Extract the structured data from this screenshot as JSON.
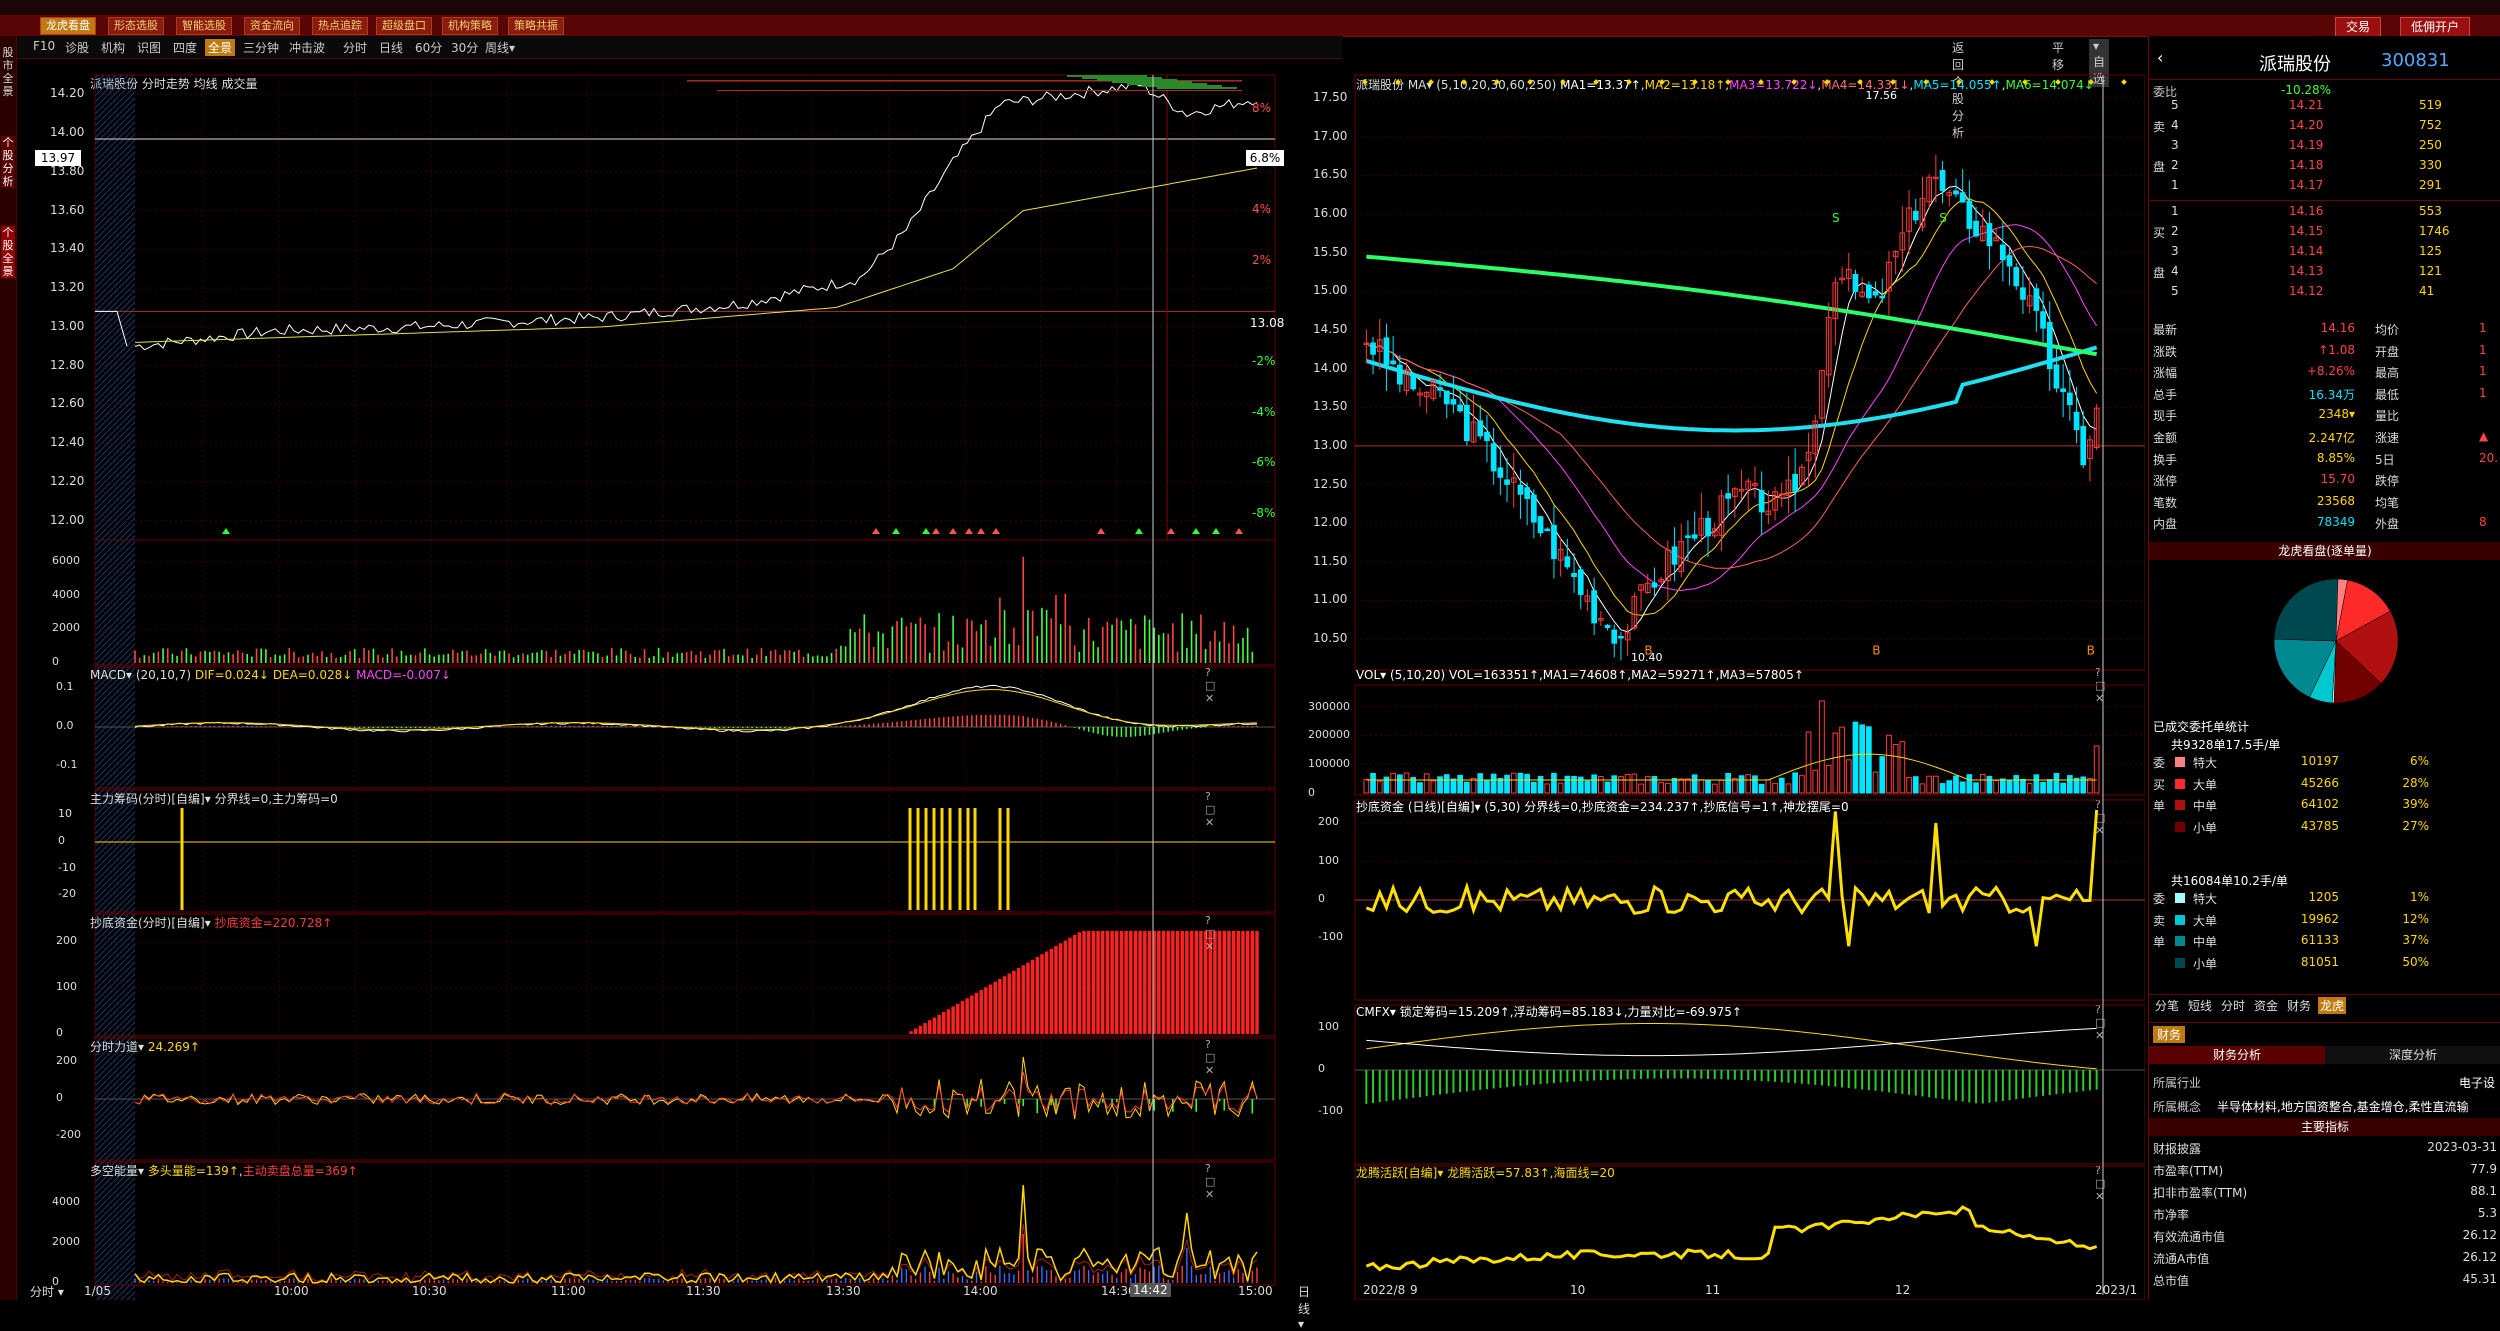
{
  "toolbar": {
    "left_buttons": [
      "龙虎看盘",
      "形态选股",
      "智能选股",
      "资金流向",
      "热点追踪",
      "超级盘口",
      "机构策略",
      "策略共振"
    ],
    "right_buttons": [
      "交易",
      "低佣开户"
    ]
  },
  "sidebar": {
    "items": [
      "股市全景",
      "个股分析",
      "个股全景"
    ]
  },
  "tabs": {
    "items": [
      "F10",
      "诊股",
      "机构",
      "识图",
      "四度",
      "全景",
      "三分钟",
      "冲击波",
      "分时",
      "日线",
      "60分",
      "30分",
      "周线▾"
    ],
    "active": "全景",
    "right_items": [
      "返回个股分析",
      "平移",
      "▾自选"
    ]
  },
  "intraday": {
    "title": "派瑞股份 分时走势 均线 成交量",
    "price_labels": [
      "14.20",
      "14.00",
      "13.80",
      "13.60",
      "13.40",
      "13.20",
      "13.00",
      "12.80",
      "12.60",
      "12.40",
      "12.20",
      "12.00"
    ],
    "pct_labels": [
      "8%",
      "6%",
      "4%",
      "2%",
      "-2%",
      "-4%",
      "-6%",
      "-8%"
    ],
    "cur_price": "13.97",
    "cur_pct": "6.8%",
    "base": "13.08",
    "vol_labels": [
      "6000",
      "4000",
      "2000",
      "0"
    ],
    "time_labels": [
      "1/05",
      "10:00",
      "10:30",
      "11:00",
      "11:30",
      "13:30",
      "14:00",
      "14:30",
      "14:42",
      "15:00"
    ],
    "bottom_left": "分时 ▾",
    "cursor_time": "14:42"
  },
  "macd_i": {
    "name": "MACD",
    "params": "(20,10,7)",
    "dif": "DIF=0.024↓",
    "dea": "DEA=0.028↓",
    "macd": "MACD=-0.007↓",
    "labels": [
      "0.1",
      "0.0",
      "-0.1"
    ]
  },
  "zhuli": {
    "name": "主力筹码(分时)[自编]",
    "text": "分界线=0,主力筹码=0",
    "labels": [
      "10",
      "0",
      "-10",
      "-20"
    ]
  },
  "chaodi_i": {
    "name": "抄底资金(分时)[自编]",
    "value": "抄底资金=220.728↑",
    "labels": [
      "200",
      "100",
      "0"
    ]
  },
  "lidao": {
    "name": "分时力道",
    "value": "24.269↑",
    "labels": [
      "200",
      "0",
      "-200"
    ]
  },
  "duokong": {
    "name": "多空能量",
    "v1": "多头量能=139↑",
    "v2": "主动卖盘总量=369↑",
    "labels": [
      "4000",
      "2000",
      "0"
    ]
  },
  "daily": {
    "title": "派瑞股份 MA▾ (5,10,20,30,60,250)",
    "ma": [
      "MA1=13.37↑",
      "MA2=13.18↑",
      "MA3=13.722↓",
      "MA4=14.331↓",
      "MA5=14.055↑",
      "MA6=14.074↓"
    ],
    "price_labels": [
      "17.50",
      "17.00",
      "16.50",
      "16.00",
      "15.50",
      "15.00",
      "14.50",
      "14.00",
      "13.50",
      "13.00",
      "12.50",
      "12.00",
      "11.50",
      "11.00",
      "10.50"
    ],
    "high_mark": "17.56",
    "low_mark": "10.40",
    "date_labels": [
      "日线 ▾",
      "2022/8",
      "9",
      "10",
      "11",
      "12",
      "2023/1"
    ]
  },
  "vol_d": {
    "title": "VOL▾ (5,10,20) VOL=163351↑,MA1=74608↑,MA2=59271↑,MA3=57805↑",
    "labels": [
      "300000",
      "200000",
      "100000",
      "0"
    ]
  },
  "chaodi_d": {
    "title": "抄底资金 (日线)[自编]▾ (5,30) 分界线=0,抄底资金=234.237↑,抄底信号=1↑,神龙摆尾=0",
    "labels": [
      "200",
      "100",
      "0",
      "-100"
    ]
  },
  "cmfx": {
    "title": "CMFX▾ 锁定筹码=15.209↑,浮动筹码=85.183↓,力量对比=-69.975↑",
    "labels": [
      "100",
      "0",
      "-100"
    ]
  },
  "longteng": {
    "title": "龙腾活跃[自编]▾ 龙腾活跃=57.83↑,海面线=20"
  },
  "quote": {
    "name": "派瑞股份",
    "code": "300831",
    "weibi_label": "委比",
    "weibi": "-10.28%",
    "sells": [
      [
        "5",
        "14.21",
        "519"
      ],
      [
        "4",
        "14.20",
        "752"
      ],
      [
        "3",
        "14.19",
        "250"
      ],
      [
        "2",
        "14.18",
        "330"
      ],
      [
        "1",
        "14.17",
        "291"
      ]
    ],
    "buys": [
      [
        "1",
        "14.16",
        "553"
      ],
      [
        "2",
        "14.15",
        "1746"
      ],
      [
        "3",
        "14.14",
        "125"
      ],
      [
        "4",
        "14.13",
        "121"
      ],
      [
        "5",
        "14.12",
        "41"
      ]
    ],
    "sell_side": [
      "卖",
      "盘"
    ],
    "buy_side": [
      "买",
      "盘"
    ],
    "stats": [
      [
        "最新",
        "14.16",
        "均价"
      ],
      [
        "涨跌",
        "↑1.08",
        "开盘"
      ],
      [
        "涨幅",
        "+8.26%",
        "最高"
      ],
      [
        "总手",
        "16.34万",
        "最低"
      ],
      [
        "现手",
        "2348▾",
        "量比"
      ],
      [
        "金额",
        "2.247亿",
        "涨速"
      ],
      [
        "换手",
        "8.85%",
        "5日"
      ],
      [
        "涨停",
        "15.70",
        "跌停"
      ],
      [
        "笔数",
        "23568",
        "均笔"
      ],
      [
        "内盘",
        "78349",
        "外盘"
      ]
    ],
    "stats_tail": [
      "1",
      "1",
      "1",
      "1",
      "",
      "▲",
      "20.",
      "",
      "",
      "8"
    ]
  },
  "lhkp": {
    "title": "龙虎看盘(逐单量)",
    "stats_title": "已成交委托单统计",
    "buy_total": "共9328单17.5手/单",
    "buy_rows": [
      [
        "特大",
        "10197",
        "6%"
      ],
      [
        "大单",
        "45266",
        "28%"
      ],
      [
        "中单",
        "64102",
        "39%"
      ],
      [
        "小单",
        "43785",
        "27%"
      ]
    ],
    "buy_side": [
      "委",
      "买",
      "单"
    ],
    "sell_total": "共16084单10.2手/单",
    "sell_rows": [
      [
        "特大",
        "1205",
        "1%"
      ],
      [
        "大单",
        "19962",
        "12%"
      ],
      [
        "中单",
        "61133",
        "37%"
      ],
      [
        "小单",
        "81051",
        "50%"
      ]
    ],
    "sell_side": [
      "委",
      "卖",
      "单"
    ],
    "pie": [
      0.03,
      0.14,
      0.2,
      0.135,
      0.005,
      0.06,
      0.185,
      0.25
    ],
    "pie_colors": [
      "#ff8080",
      "#ff2a2a",
      "#b01010",
      "#700000",
      "#9fffff",
      "#00c8d0",
      "#008890",
      "#004850"
    ],
    "tabs": [
      "分笔",
      "短线",
      "分时",
      "资金",
      "财务",
      "龙虎"
    ],
    "tab_active": "龙虎"
  },
  "finance": {
    "tag": "财务",
    "tab1": "财务分析",
    "tab2": "深度分析",
    "industry_label": "所属行业",
    "industry": "电子设",
    "concept_label": "所属概念",
    "concept": "半导体材料,地方国资整合,基金增仓,柔性直流输",
    "main_title": "主要指标",
    "rows": [
      [
        "财报披露",
        "2023-03-31"
      ],
      [
        "市盈率(TTM)",
        "77.9"
      ],
      [
        "扣非市盈率(TTM)",
        "88.1"
      ],
      [
        "市净率",
        "5.3"
      ],
      [
        "有效流通市值",
        "26.12"
      ],
      [
        "流通A市值",
        "26.12"
      ],
      [
        "总市值",
        "45.31"
      ]
    ]
  }
}
